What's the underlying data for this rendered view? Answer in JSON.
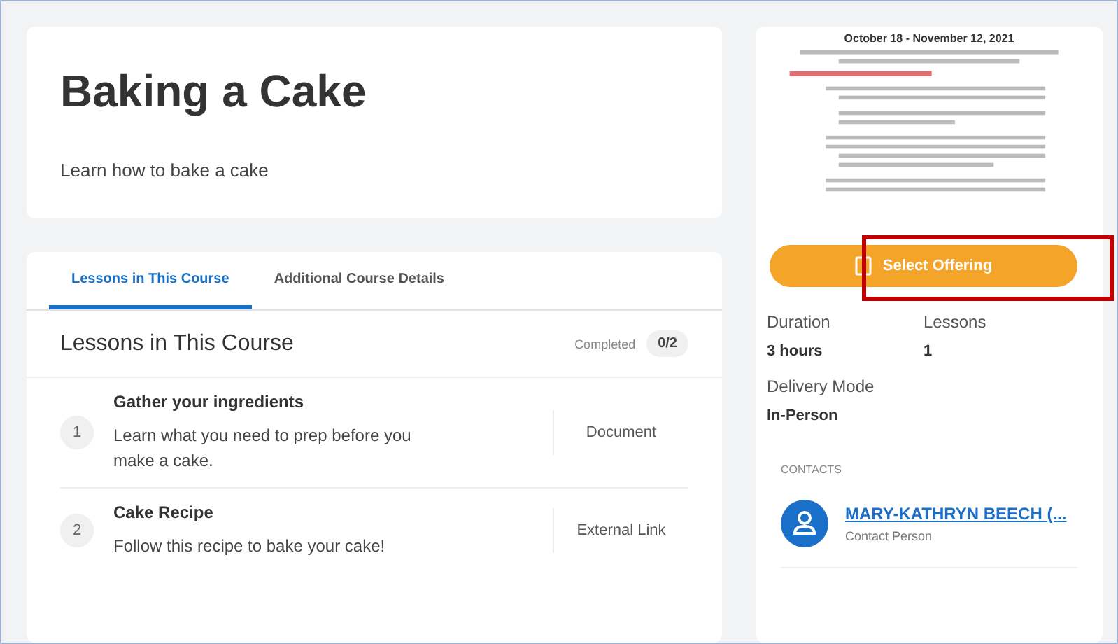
{
  "course": {
    "title": "Baking a Cake",
    "description": "Learn how to bake a cake"
  },
  "tabs": [
    {
      "label": "Lessons in This Course",
      "selected": true
    },
    {
      "label": "Additional Course Details",
      "selected": false
    }
  ],
  "lessons_section": {
    "heading": "Lessons in This Course",
    "completed_label": "Completed",
    "completed_count": "0/2"
  },
  "lessons": [
    {
      "number": "1",
      "title": "Gather your ingredients",
      "description": "Learn what you need to prep before you make a cake.",
      "type": "Document"
    },
    {
      "number": "2",
      "title": "Cake Recipe",
      "description": "Follow this recipe to bake your cake!",
      "type": "External Link"
    }
  ],
  "offering": {
    "document_preview": {
      "heading": "October 18 - November 12, 2021"
    },
    "button": "Select Offering",
    "highlighted": true
  },
  "details": [
    {
      "label": "Duration",
      "value": "3 hours"
    },
    {
      "label": "Lessons",
      "value": "1"
    },
    {
      "label": "Delivery Mode",
      "value": "In-Person"
    }
  ],
  "contacts": {
    "heading": "CONTACTS",
    "items": [
      {
        "name": "MARY-KATHRYN BEECH (...",
        "role": "Contact Person"
      }
    ]
  }
}
